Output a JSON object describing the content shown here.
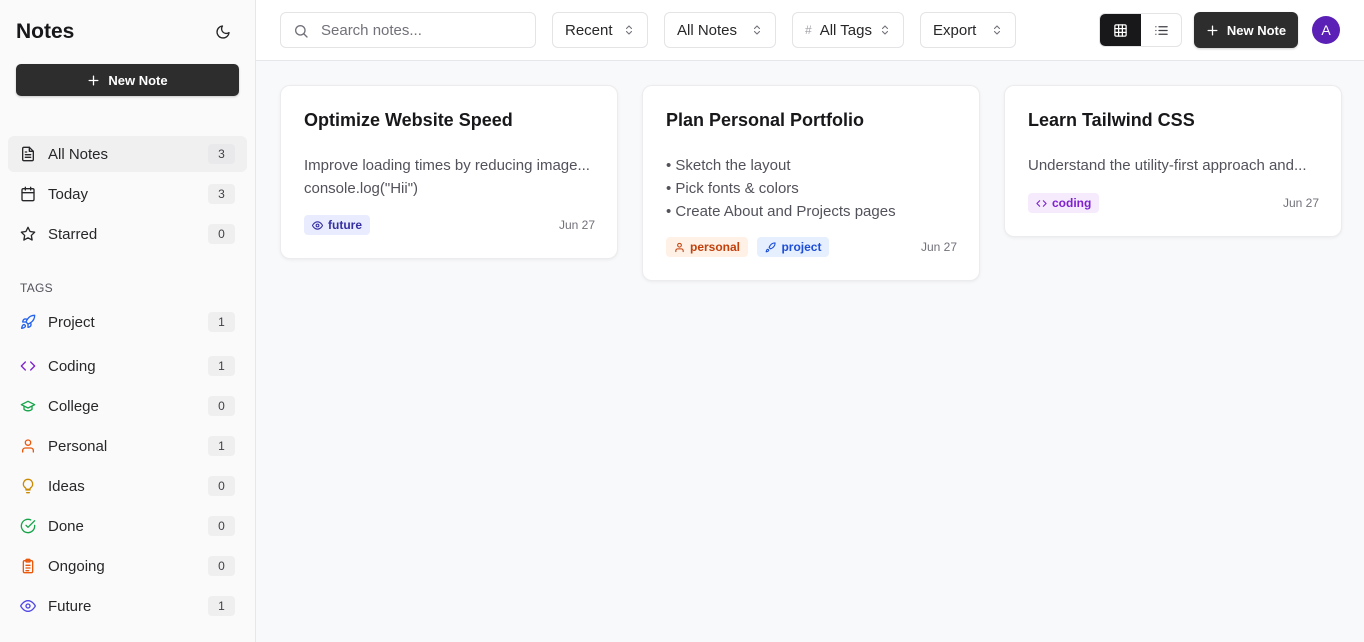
{
  "sidebar": {
    "title": "Notes",
    "new_note_label": "New Note",
    "nav": [
      {
        "label": "All Notes",
        "count": "3"
      },
      {
        "label": "Today",
        "count": "3"
      },
      {
        "label": "Starred",
        "count": "0"
      }
    ],
    "tags_heading": "TAGS",
    "tags": [
      {
        "label": "Project",
        "count": "1",
        "icon": "rocket-icon",
        "color": "#2563eb"
      },
      {
        "label": "Coding",
        "count": "1",
        "icon": "code-icon",
        "color": "#7e22ce"
      },
      {
        "label": "College",
        "count": "0",
        "icon": "graduation-cap-icon",
        "color": "#16a34a"
      },
      {
        "label": "Personal",
        "count": "1",
        "icon": "user-icon",
        "color": "#ea580c"
      },
      {
        "label": "Ideas",
        "count": "0",
        "icon": "lightbulb-icon",
        "color": "#ca8a04"
      },
      {
        "label": "Done",
        "count": "0",
        "icon": "check-circle-icon",
        "color": "#16a34a"
      },
      {
        "label": "Ongoing",
        "count": "0",
        "icon": "clipboard-icon",
        "color": "#ea580c"
      },
      {
        "label": "Future",
        "count": "1",
        "icon": "eye-icon",
        "color": "#4f46e5"
      }
    ]
  },
  "toolbar": {
    "search_placeholder": "Search notes...",
    "sort_label": "Recent",
    "notes_filter_label": "All Notes",
    "tags_filter_label": "All Tags",
    "tags_filter_prefix": "#",
    "export_label": "Export",
    "new_note_label": "New Note",
    "avatar_initial": "A",
    "view_mode": "grid"
  },
  "notes": [
    {
      "title": "Optimize Website Speed",
      "lines": [
        "Improve loading times by reducing image...",
        "console.log(\"Hii\")"
      ],
      "tags": [
        {
          "label": "future",
          "icon": "eye-icon"
        }
      ],
      "date": "Jun 27"
    },
    {
      "title": "Plan Personal Portfolio",
      "lines": [
        "• Sketch the layout",
        "• Pick fonts & colors",
        "• Create About and Projects pages"
      ],
      "tags": [
        {
          "label": "personal",
          "icon": "user-icon"
        },
        {
          "label": "project",
          "icon": "rocket-icon"
        }
      ],
      "date": "Jun 27"
    },
    {
      "title": "Learn Tailwind CSS",
      "lines": [
        "Understand the utility-first approach and..."
      ],
      "tags": [
        {
          "label": "coding",
          "icon": "code-icon"
        }
      ],
      "date": "Jun 27"
    }
  ],
  "colors": {
    "primary_button": "#2d2d2d",
    "avatar": "#5b21b6",
    "active_toggle": "#18181b"
  }
}
